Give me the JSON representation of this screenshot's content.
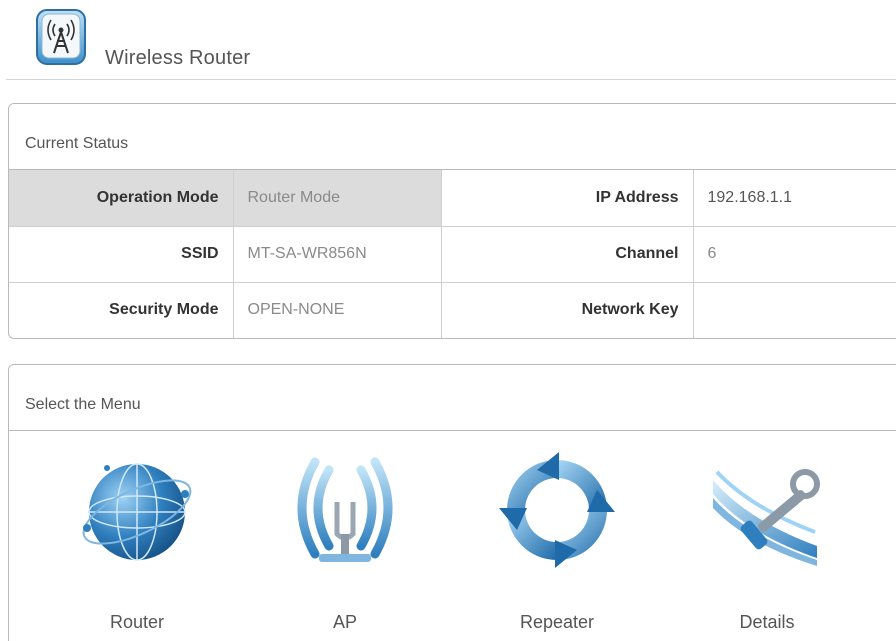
{
  "header": {
    "title": "Wireless Router",
    "logo_icon": "wireless-tower-icon"
  },
  "status": {
    "panel_title": "Current Status",
    "rows": [
      {
        "label_left": "Operation Mode",
        "value_left": "Router Mode",
        "label_right": "IP Address",
        "value_right": "192.168.1.1"
      },
      {
        "label_left": "SSID",
        "value_left": "MT-SA-WR856N",
        "label_right": "Channel",
        "value_right": "6"
      },
      {
        "label_left": "Security Mode",
        "value_left": "OPEN-NONE",
        "label_right": "Network Key",
        "value_right": ""
      }
    ]
  },
  "menu": {
    "panel_title": "Select the Menu",
    "items": [
      {
        "label": "Router",
        "icon": "globe-icon"
      },
      {
        "label": "AP",
        "icon": "antenna-icon"
      },
      {
        "label": "Repeater",
        "icon": "refresh-icon"
      },
      {
        "label": "Details",
        "icon": "tools-icon"
      }
    ]
  },
  "colors": {
    "accent_blue": "#2f7fbf",
    "shade_gray": "#dcdcdc",
    "border_gray": "#b9b9b9"
  }
}
